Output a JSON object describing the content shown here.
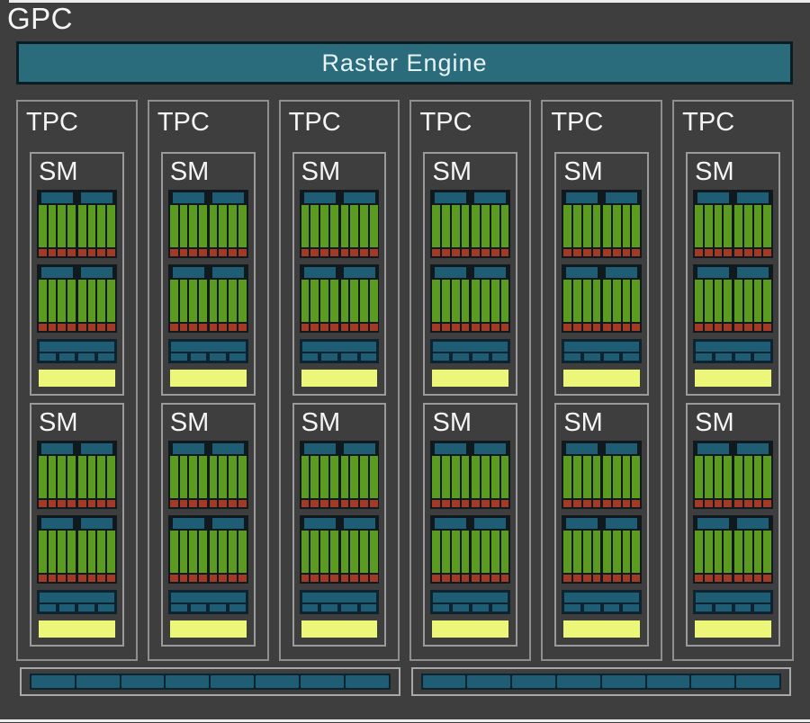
{
  "gpc": {
    "label": "GPC"
  },
  "raster_engine": {
    "label": "Raster Engine"
  },
  "tpcs": {
    "label": "TPC",
    "count": 6
  },
  "sm": {
    "label": "SM",
    "per_tpc": 2,
    "partition_groups_per_sm": 2,
    "partitions_per_group": 2,
    "green_columns_per_partition": 4,
    "red_segments_per_partition": 4,
    "ldst_segments": 4
  },
  "bottom_bars": {
    "count": 2,
    "segments_per_bar": 8
  },
  "colors": {
    "bg": "#3e3e3e",
    "raster_teal": "#2a6b7c",
    "unit_teal": "#1f5d75",
    "core_green": "#5b9b1f",
    "unit_red": "#a23a26",
    "cache_yellow": "#ecf678",
    "dark_navy": "#0d2430",
    "partition_dark": "#10191d",
    "box_border": "#9a9a9a",
    "outer_border": "#ececec",
    "text": "#f5f5f5"
  }
}
